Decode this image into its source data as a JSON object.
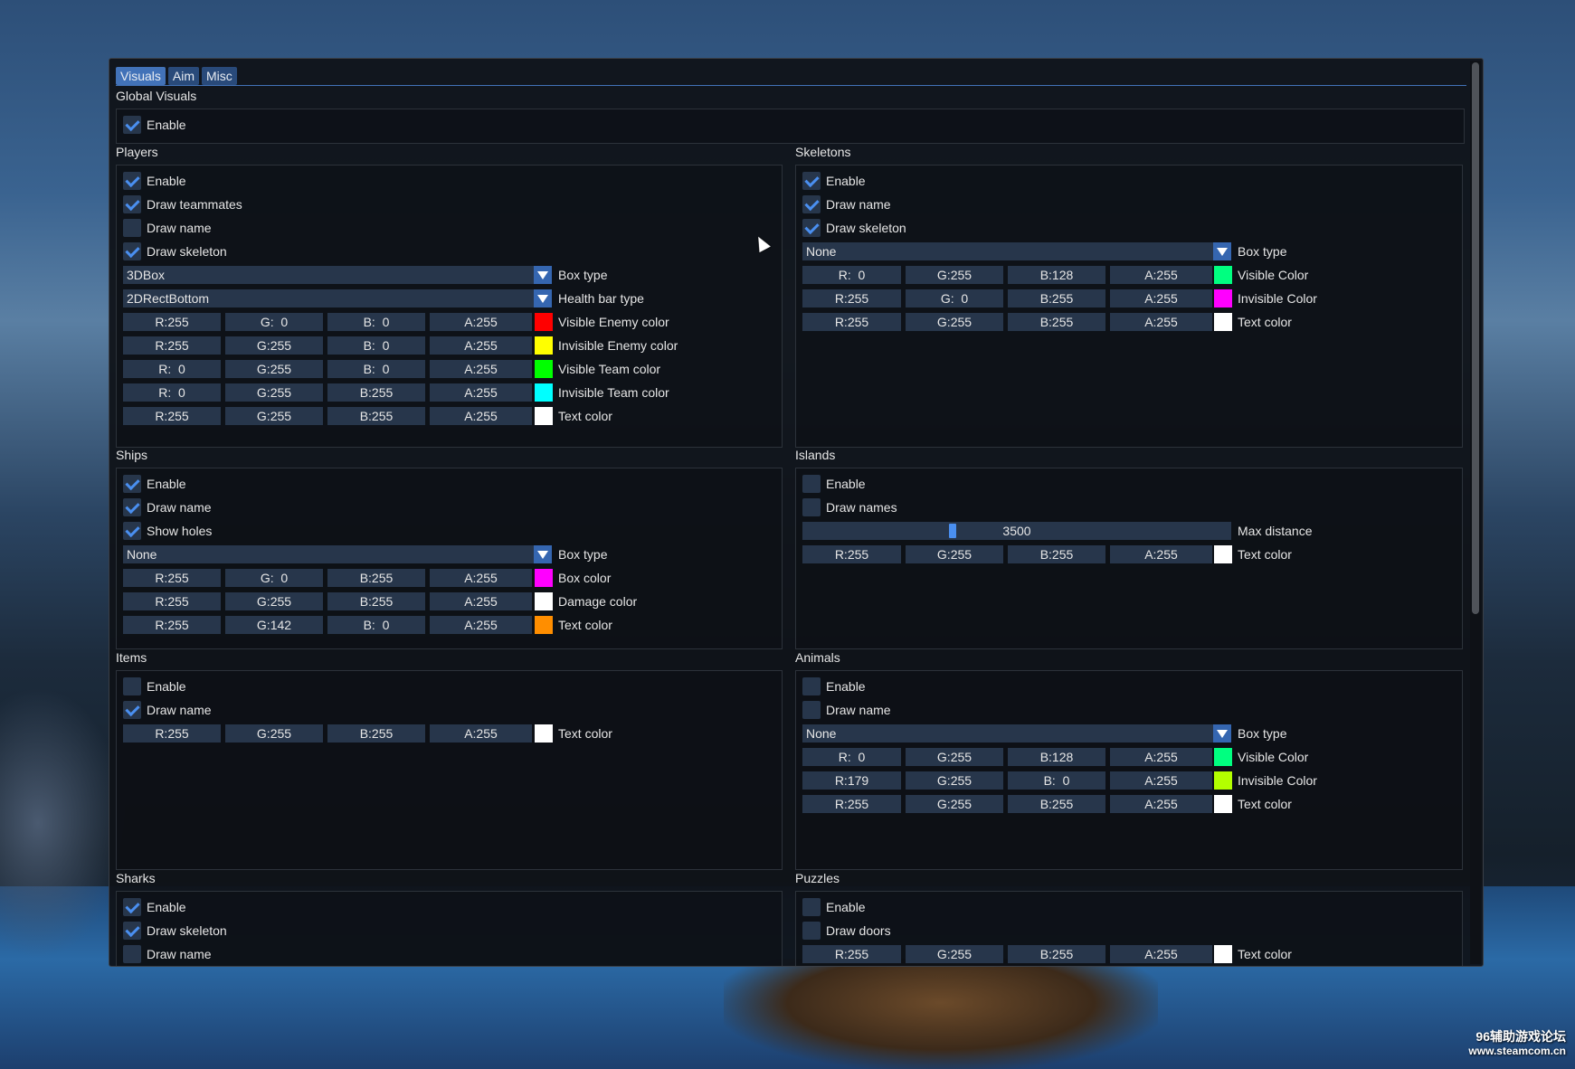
{
  "tabs": [
    "Visuals",
    "Aim",
    "Misc"
  ],
  "global_visuals": {
    "title": "Global Visuals",
    "enable": "Enable"
  },
  "players": {
    "title": "Players",
    "checks": [
      {
        "label": "Enable",
        "checked": true
      },
      {
        "label": "Draw teammates",
        "checked": true
      },
      {
        "label": "Draw name",
        "checked": false
      },
      {
        "label": "Draw skeleton",
        "checked": true
      }
    ],
    "combos": [
      {
        "value": "3DBox",
        "label": "Box type"
      },
      {
        "value": "2DRectBottom",
        "label": "Health bar type"
      }
    ],
    "colors": [
      {
        "r": "R:255",
        "g": "G:  0",
        "b": "B:  0",
        "a": "A:255",
        "swatch": "#ff0000",
        "label": "Visible Enemy color"
      },
      {
        "r": "R:255",
        "g": "G:255",
        "b": "B:  0",
        "a": "A:255",
        "swatch": "#ffff00",
        "label": "Invisible Enemy color"
      },
      {
        "r": "R:  0",
        "g": "G:255",
        "b": "B:  0",
        "a": "A:255",
        "swatch": "#00ff00",
        "label": "Visible Team color"
      },
      {
        "r": "R:  0",
        "g": "G:255",
        "b": "B:255",
        "a": "A:255",
        "swatch": "#00ffff",
        "label": "Invisible Team color"
      },
      {
        "r": "R:255",
        "g": "G:255",
        "b": "B:255",
        "a": "A:255",
        "swatch": "#ffffff",
        "label": "Text color"
      }
    ]
  },
  "skeletons": {
    "title": "Skeletons",
    "checks": [
      {
        "label": "Enable",
        "checked": true
      },
      {
        "label": "Draw name",
        "checked": true
      },
      {
        "label": "Draw skeleton",
        "checked": true
      }
    ],
    "combos": [
      {
        "value": "None",
        "label": "Box type"
      }
    ],
    "colors": [
      {
        "r": "R:  0",
        "g": "G:255",
        "b": "B:128",
        "a": "A:255",
        "swatch": "#00ff80",
        "label": "Visible Color"
      },
      {
        "r": "R:255",
        "g": "G:  0",
        "b": "B:255",
        "a": "A:255",
        "swatch": "#ff00ff",
        "label": "Invisible Color"
      },
      {
        "r": "R:255",
        "g": "G:255",
        "b": "B:255",
        "a": "A:255",
        "swatch": "#ffffff",
        "label": "Text color"
      }
    ]
  },
  "ships": {
    "title": "Ships",
    "checks": [
      {
        "label": "Enable",
        "checked": true
      },
      {
        "label": "Draw name",
        "checked": true
      },
      {
        "label": "Show holes",
        "checked": true
      }
    ],
    "combos": [
      {
        "value": "None",
        "label": "Box type"
      }
    ],
    "colors": [
      {
        "r": "R:255",
        "g": "G:  0",
        "b": "B:255",
        "a": "A:255",
        "swatch": "#ff00ff",
        "label": "Box color"
      },
      {
        "r": "R:255",
        "g": "G:255",
        "b": "B:255",
        "a": "A:255",
        "swatch": "#ffffff",
        "label": "Damage color"
      },
      {
        "r": "R:255",
        "g": "G:142",
        "b": "B:  0",
        "a": "A:255",
        "swatch": "#ff8e00",
        "label": "Text color"
      }
    ]
  },
  "islands": {
    "title": "Islands",
    "checks": [
      {
        "label": "Enable",
        "checked": false
      },
      {
        "label": "Draw names",
        "checked": false
      }
    ],
    "slider": {
      "value": "3500",
      "label": "Max distance",
      "fraction": 0.35
    },
    "colors": [
      {
        "r": "R:255",
        "g": "G:255",
        "b": "B:255",
        "a": "A:255",
        "swatch": "#ffffff",
        "label": "Text color"
      }
    ]
  },
  "items": {
    "title": "Items",
    "checks": [
      {
        "label": "Enable",
        "checked": false
      },
      {
        "label": "Draw name",
        "checked": true
      }
    ],
    "colors": [
      {
        "r": "R:255",
        "g": "G:255",
        "b": "B:255",
        "a": "A:255",
        "swatch": "#ffffff",
        "label": "Text color"
      }
    ]
  },
  "animals": {
    "title": "Animals",
    "checks": [
      {
        "label": "Enable",
        "checked": false
      },
      {
        "label": "Draw name",
        "checked": false
      }
    ],
    "combos": [
      {
        "value": "None",
        "label": "Box type"
      }
    ],
    "colors": [
      {
        "r": "R:  0",
        "g": "G:255",
        "b": "B:128",
        "a": "A:255",
        "swatch": "#00ff80",
        "label": "Visible Color"
      },
      {
        "r": "R:179",
        "g": "G:255",
        "b": "B:  0",
        "a": "A:255",
        "swatch": "#b3ff00",
        "label": "Invisible Color"
      },
      {
        "r": "R:255",
        "g": "G:255",
        "b": "B:255",
        "a": "A:255",
        "swatch": "#ffffff",
        "label": "Text color"
      }
    ]
  },
  "sharks": {
    "title": "Sharks",
    "checks": [
      {
        "label": "Enable",
        "checked": true
      },
      {
        "label": "Draw skeleton",
        "checked": true
      },
      {
        "label": "Draw name",
        "checked": false
      }
    ]
  },
  "puzzles": {
    "title": "Puzzles",
    "checks": [
      {
        "label": "Enable",
        "checked": false
      },
      {
        "label": "Draw doors",
        "checked": false
      }
    ],
    "colors": [
      {
        "r": "R:255",
        "g": "G:255",
        "b": "B:255",
        "a": "A:255",
        "swatch": "#ffffff",
        "label": "Text color"
      }
    ]
  },
  "watermark": {
    "line1": "96辅助游戏论坛",
    "line2": "www.steamcom.cn"
  }
}
